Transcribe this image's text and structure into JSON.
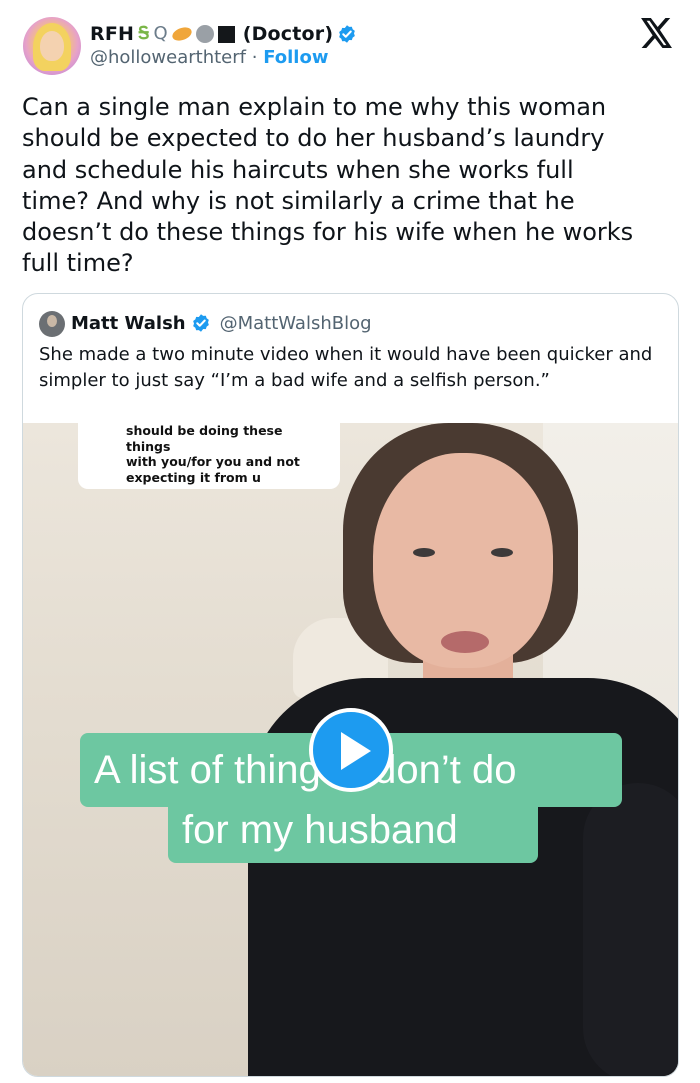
{
  "author": {
    "display_name": "RFH",
    "name_suffix": "(Doctor)",
    "emoji_icons": [
      "lizard-emoji",
      "magnifier-emoji",
      "saturn-emoji",
      "moon-emoji",
      "black-square-emoji"
    ],
    "handle": "@hollowearthterf",
    "separator": "·",
    "follow_label": "Follow",
    "verified": true
  },
  "tweet_text": "Can a single man explain to me why this woman\nshould be expected to do her husband’s laundry\nand schedule his haircuts when she works full\ntime? And why is not similarly a crime that he\ndoesn’t do these things for his wife when he works\nfull time?",
  "quote": {
    "display_name": "Matt Walsh",
    "handle": "@MattWalshBlog",
    "verified": true,
    "text": "She made a two minute video when it would have been quicker and simpler to just say “I’m a bad wife and a selfish person.”",
    "video": {
      "caption_lines": [
        "should be doing these things",
        "with you/for you and not",
        "expecting it from u"
      ],
      "banner_line1": "A list of things I don’t do",
      "banner_line2": "for my husband"
    }
  },
  "colors": {
    "accent": "#1d9bf0",
    "text": "#0f1419",
    "muted": "#536471",
    "banner": "#6dc7a1"
  }
}
